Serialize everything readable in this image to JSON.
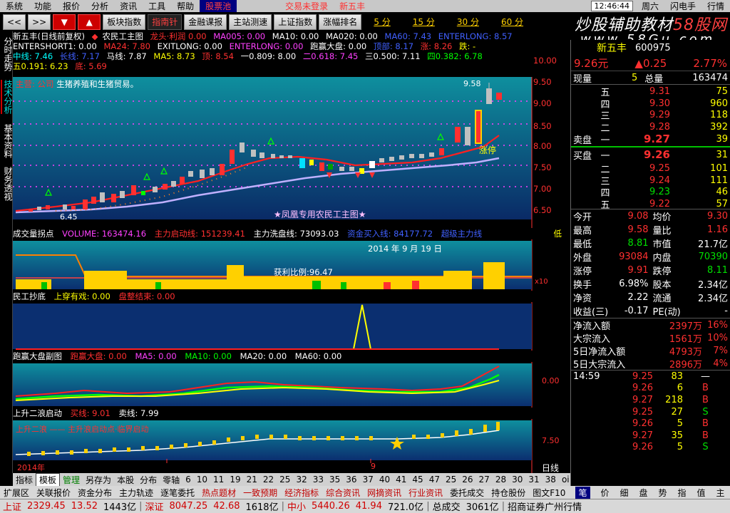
{
  "menu": [
    "系统",
    "功能",
    "报价",
    "分析",
    "资讯",
    "工具",
    "帮助",
    "股票池"
  ],
  "menu_extra": [
    "交易未登录",
    "新五丰"
  ],
  "clock": "12:46:44",
  "weekday": "周六",
  "flash_trade": "闪电手",
  "quote_menu": "行情",
  "toolbar": {
    "back": "<<",
    "fwd": ">>",
    "down": "▼",
    "up": "▲",
    "buttons": [
      "板块指数",
      "指南针",
      "金融课报",
      "主站测速",
      "上证指数",
      "涨幅排名"
    ],
    "periods": [
      "5 分",
      "15 分",
      "30 分",
      "60 分"
    ]
  },
  "banner": {
    "line1a": "炒股辅助教材",
    "line1b": "58股网",
    "line2": "www.58Gu.com"
  },
  "left_tabs": [
    "分时走势",
    "技术分析",
    "基本资料",
    "财务透视"
  ],
  "indicator_lines": {
    "l1": [
      "新五丰(日线前复权)",
      "农民工主图",
      "龙头·利润 0.00",
      "MA005: 0.00",
      "MA10: 0.00",
      "MA020: 0.00",
      "MA60: 7.43",
      "ENTERLONG: 8.57"
    ],
    "l2": [
      "ENTERSHORT1: 0.00",
      "MA24: 7.80",
      "EXITLONG: 0.00",
      "ENTERLONG: 0.00",
      "跑赢大盘: 0.00",
      "顶部: 8.17",
      "涨: 8.26",
      "跌: -"
    ],
    "l3": [
      "中线: 7.46",
      "长线: 7.17",
      "马线: 7.87",
      "MA5: 8.73",
      "顶: 8.54",
      "一0.809: 8.00",
      "二0.618: 7.45",
      "三0.500: 7.11",
      "四0.382: 6.78"
    ],
    "l4": [
      "五0.191: 6.23",
      "底: 5.69"
    ]
  },
  "main_chart": {
    "caption": "生猪养殖和生猪贸易。",
    "caption_prefix": "主营: 公司",
    "watermark": "★凤凰专用农民工主图★",
    "high_label": "9.58",
    "low_label": "6.45",
    "limit_up": "涨停",
    "y_ticks": [
      "10.00",
      "9.50",
      "9.00",
      "8.50",
      "8.00",
      "7.50",
      "7.00",
      "6.50"
    ]
  },
  "volume_panel": {
    "title": "成交量拐点",
    "items": [
      "VOLUME: 163474.16",
      "主力启动线: 151239.41",
      "主力洗盘线: 73093.03",
      "资金买入线: 84177.72",
      "超级主力线"
    ],
    "date": "2014 年 9 月 19 日",
    "profit": "获利比例:96.47",
    "right": "低",
    "scale": "x10"
  },
  "panel3": {
    "title": "民工抄底",
    "items": [
      "上穿有戏: 0.00",
      "盘整结束: 0.00"
    ]
  },
  "panel4": {
    "title": "跑赢大盘副图",
    "items": [
      "跑赢大盘: 0.00",
      "MA5: 0.00",
      "MA10: 0.00",
      "MA20: 0.00",
      "MA60: 0.00"
    ],
    "tick": "0.00"
  },
  "panel5": {
    "title": "上升二浪启动",
    "items": [
      "买线: 9.01",
      "卖线: 7.99"
    ],
    "sub": "上升二浪 —— 主升浪启动点·临界启动",
    "tick": "7.50"
  },
  "x_axis": {
    "year": "2014年",
    "mark": "9",
    "daily": "日线"
  },
  "bottom_tabs": [
    "指标",
    "模板",
    "管理",
    "另存为",
    "本股",
    "分布",
    "零轴",
    "6",
    "10",
    "11",
    "19",
    "21",
    "22",
    "25",
    "32",
    "33",
    "35",
    "36",
    "37",
    "40",
    "41",
    "45",
    "47",
    "25",
    "26",
    "27",
    "28",
    "30",
    "31",
    "38",
    "oi",
    "+",
    "-"
  ],
  "info_bar": [
    "扩展区",
    "关联报价",
    "资金分布",
    "主力轨迹",
    "逐笔委托",
    "热点题材",
    "一致预期",
    "经济指标",
    "综合资讯",
    "网摘资讯",
    "行业资讯",
    "委托成交",
    "持仓股份",
    "图文F10"
  ],
  "status_bar": [
    {
      "name": "上证",
      "val": "2329.45",
      "chg": "13.52",
      "amt": "1443亿"
    },
    {
      "name": "深证",
      "val": "8047.25",
      "chg": "42.68",
      "amt": "1618亿"
    },
    {
      "name": "中小",
      "val": "5440.26",
      "chg": "41.94",
      "amt": "721.0亿"
    }
  ],
  "status_tail": [
    "总成交",
    "3061亿",
    "招商证券广州行情"
  ],
  "quote": {
    "name": "新五丰",
    "code": "600975",
    "price": "9.26元",
    "change": "▲0.25",
    "pct": "2.77%",
    "now_label": "现量",
    "now_val": "5",
    "total_label": "总量",
    "total_val": "163474",
    "sell_label": "卖盘",
    "buy_label": "买盘",
    "asks": [
      {
        "lvl": "五",
        "px": "9.31",
        "vol": "75"
      },
      {
        "lvl": "四",
        "px": "9.30",
        "vol": "960"
      },
      {
        "lvl": "三",
        "px": "9.29",
        "vol": "118"
      },
      {
        "lvl": "二",
        "px": "9.28",
        "vol": "392"
      },
      {
        "lvl": "一",
        "px": "9.27",
        "vol": "39"
      }
    ],
    "bids": [
      {
        "lvl": "一",
        "px": "9.26",
        "vol": "31"
      },
      {
        "lvl": "二",
        "px": "9.25",
        "vol": "101"
      },
      {
        "lvl": "三",
        "px": "9.24",
        "vol": "111"
      },
      {
        "lvl": "四",
        "px": "9.23",
        "vol": "46"
      },
      {
        "lvl": "五",
        "px": "9.22",
        "vol": "57"
      }
    ],
    "stats": [
      [
        "今开",
        "9.08",
        "均价",
        "9.30"
      ],
      [
        "最高",
        "9.58",
        "量比",
        "1.16"
      ],
      [
        "最低",
        "8.81",
        "市值",
        "21.7亿"
      ],
      [
        "外盘",
        "93084",
        "内盘",
        "70390"
      ],
      [
        "涨停",
        "9.91",
        "跌停",
        "8.11"
      ],
      [
        "换手",
        "6.98%",
        "股本",
        "2.34亿"
      ],
      [
        "净资",
        "2.22",
        "流通",
        "2.34亿"
      ],
      [
        "收益(三)",
        "-0.17",
        "PE(动)",
        "-"
      ]
    ],
    "flows": [
      [
        "净流入额",
        "2397万",
        "16%"
      ],
      [
        "大宗流入",
        "1561万",
        "10%"
      ],
      [
        "5日净流入额",
        "4793万",
        "7%"
      ],
      [
        "5日大宗流入",
        "2896万",
        "4%"
      ]
    ],
    "ticks": [
      {
        "t": "14:59",
        "p": "9.25",
        "v": "83",
        "s": "—"
      },
      {
        "t": "",
        "p": "9.26",
        "v": "6",
        "s": "B"
      },
      {
        "t": "",
        "p": "9.27",
        "v": "218",
        "s": "B"
      },
      {
        "t": "",
        "p": "9.25",
        "v": "27",
        "s": "S"
      },
      {
        "t": "",
        "p": "9.26",
        "v": "5",
        "s": "B"
      },
      {
        "t": "",
        "p": "9.27",
        "v": "35",
        "s": "B"
      },
      {
        "t": "",
        "p": "9.26",
        "v": "5",
        "s": "S"
      }
    ]
  },
  "quote_tabs": [
    "笔",
    "价",
    "细",
    "盘",
    "势",
    "指",
    "值",
    "主"
  ]
}
